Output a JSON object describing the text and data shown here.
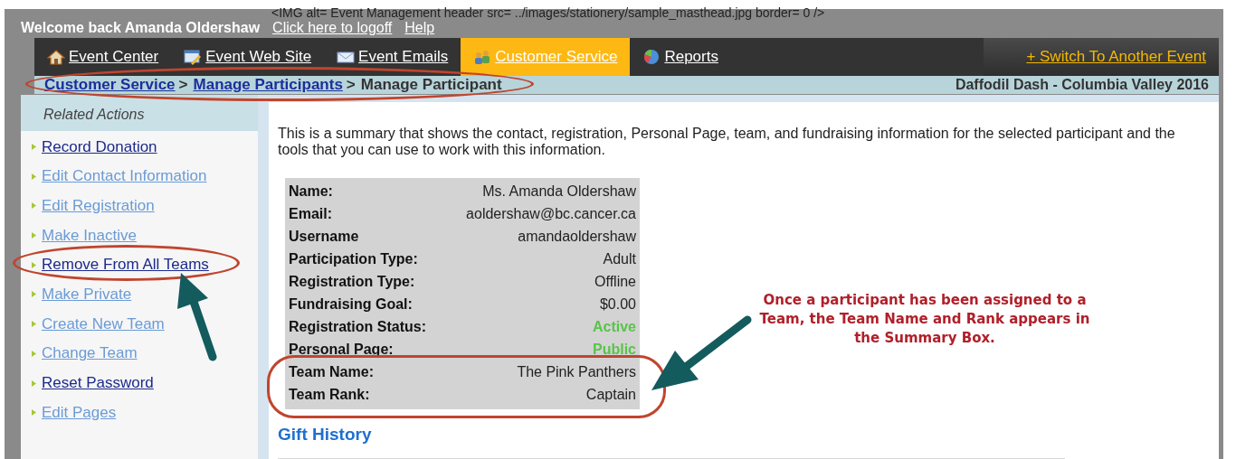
{
  "source_line": "<IMG alt= Event Management header  src= ../images/stationery/sample_masthead.jpg  border= 0 />",
  "header": {
    "welcome": "Welcome back Amanda Oldershaw",
    "links": [
      "Click here to logoff",
      "Help"
    ]
  },
  "nav": {
    "tabs": [
      {
        "label": "Event Center",
        "selected": false
      },
      {
        "label": "Event Web Site",
        "selected": false
      },
      {
        "label": "Event Emails",
        "selected": false
      },
      {
        "label": "Customer Service",
        "selected": true
      },
      {
        "label": "Reports",
        "selected": false
      }
    ],
    "switch_link": "+ Switch To Another Event"
  },
  "breadcrumb": {
    "links": [
      "Customer Service",
      "Manage Participants"
    ],
    "separator": ">",
    "current": "Manage Participant",
    "event": "Daffodil Dash - Columbia Valley 2016"
  },
  "sidebar": {
    "title": "Related Actions",
    "items": [
      {
        "label": "Record Donation",
        "dimmed": false
      },
      {
        "label": "Edit Contact Information",
        "dimmed": true
      },
      {
        "label": "Edit Registration",
        "dimmed": true
      },
      {
        "label": "Make Inactive",
        "dimmed": true
      },
      {
        "label": "Remove From All Teams",
        "dimmed": false
      },
      {
        "label": "Make Private",
        "dimmed": true
      },
      {
        "label": "Create New Team",
        "dimmed": true
      },
      {
        "label": "Change Team",
        "dimmed": true
      },
      {
        "label": "Reset Password",
        "dimmed": false
      },
      {
        "label": "Edit Pages",
        "dimmed": true
      }
    ]
  },
  "intro": "This is a summary that shows the contact, registration, Personal Page, team, and fundraising information for the selected participant and the tools that you can use to work with this information.",
  "summary": [
    {
      "label": "Name:",
      "value": "Ms. Amanda Oldershaw",
      "highlight": false
    },
    {
      "label": "Email:",
      "value": "aoldershaw@bc.cancer.ca",
      "highlight": false
    },
    {
      "label": "Username",
      "value": "amandaoldershaw",
      "highlight": false
    },
    {
      "label": "Participation Type:",
      "value": "Adult",
      "highlight": false
    },
    {
      "label": "Registration Type:",
      "value": "Offline",
      "highlight": false
    },
    {
      "label": "Fundraising Goal:",
      "value": "$0.00",
      "highlight": false
    },
    {
      "label": "Registration Status:",
      "value": "Active",
      "highlight": true
    },
    {
      "label": "Personal Page:",
      "value": "Public",
      "highlight": true
    },
    {
      "label": "Team Name:",
      "value": "The Pink Panthers",
      "highlight": false
    },
    {
      "label": "Team Rank:",
      "value": "Captain",
      "highlight": false
    }
  ],
  "section_heading": "Gift History",
  "callout": "Once a participant has been assigned to a Team, the Team Name and Rank appears in the Summary Box."
}
